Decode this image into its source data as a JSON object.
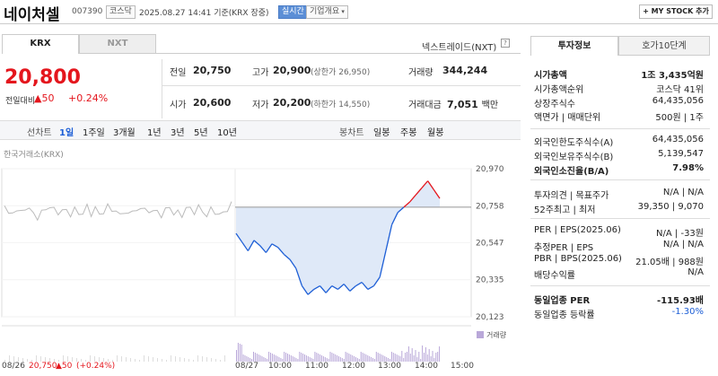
{
  "header": {
    "name": "네이처셀",
    "code": "007390",
    "market": "코스닥",
    "datetime": "2025.08.27 14:41 기준(KRX 장중)",
    "live": "실시간",
    "company": "기업개요",
    "mystock": "+ MY STOCK 추가"
  },
  "tabs": {
    "krx": "KRX",
    "nxt": "NXT",
    "next_trade": "넥스트레이드(NXT)",
    "help": "?"
  },
  "price": {
    "current": "20,800",
    "change_label": "전일대비",
    "change": "▲50",
    "change_pct": "+0.24%"
  },
  "summary": {
    "prev_label": "전일",
    "prev": "20,750",
    "high_label": "고가",
    "high": "20,900",
    "high_limit": "(상한가 26,950)",
    "volume_label": "거래량",
    "volume": "344,244",
    "open_label": "시가",
    "open": "20,600",
    "low_label": "저가",
    "low": "20,200",
    "low_limit": "(하한가 14,550)",
    "amount_label": "거래대금",
    "amount": "7,051",
    "amount_unit": "백만"
  },
  "periods": {
    "line_label": "선차트",
    "items": [
      "1일",
      "1주일",
      "3개월",
      "1년",
      "3년",
      "5년",
      "10년"
    ],
    "candle_label": "봉차트",
    "candles": [
      "일봉",
      "주봉",
      "월봉"
    ]
  },
  "chart_data": {
    "type": "line",
    "source": "한국거래소(KRX)",
    "y_ticks": [
      "20,970",
      "20,758",
      "20,547",
      "20,335",
      "20,123"
    ],
    "ylim": [
      20123,
      20970
    ],
    "prev_close": 20750,
    "x_ticks": [
      "08/27",
      "10:00",
      "11:00",
      "12:00",
      "13:00",
      "14:00",
      "15:00"
    ],
    "prev_day": {
      "date": "08/26",
      "close": "20,750",
      "change": "▲50",
      "change_pct": "(+0.24%)"
    },
    "volume_label": "거래량",
    "colors": {
      "up": "#e4161d",
      "down": "#1e5fd6",
      "fill": "#dfe9f8",
      "prev": "#bbbbbb"
    },
    "series": [
      {
        "x": [
          "09:00",
          "09:10",
          "09:20",
          "09:30",
          "09:40",
          "09:50",
          "10:00",
          "10:10",
          "10:20",
          "10:30",
          "10:40",
          "10:50",
          "11:00",
          "11:10",
          "11:20",
          "11:30",
          "11:40",
          "11:50",
          "12:00",
          "12:10",
          "12:20",
          "12:30",
          "12:40",
          "12:50",
          "13:00",
          "13:10",
          "13:20",
          "13:30",
          "13:40",
          "13:50",
          "14:00",
          "14:10",
          "14:20",
          "14:30",
          "14:41"
        ],
        "values": [
          20600,
          20550,
          20500,
          20560,
          20530,
          20490,
          20540,
          20520,
          20480,
          20450,
          20400,
          20300,
          20250,
          20280,
          20300,
          20260,
          20300,
          20280,
          20310,
          20270,
          20300,
          20320,
          20280,
          20300,
          20350,
          20500,
          20650,
          20720,
          20750,
          20780,
          20820,
          20860,
          20900,
          20850,
          20800
        ]
      }
    ]
  },
  "invest": {
    "tab1": "투자정보",
    "tab2": "호가10단계",
    "rows": [
      {
        "label": "시가총액",
        "value": "1조 3,435억원",
        "bold": true
      },
      {
        "label": "시가총액순위",
        "value": "코스닥 41위"
      },
      {
        "label": "상장주식수",
        "value": "64,435,056"
      },
      {
        "label": "액면가 | 매매단위",
        "value": "500원 | 1주"
      },
      {
        "label": "외국인한도주식수(A)",
        "value": "64,435,056"
      },
      {
        "label": "외국인보유주식수(B)",
        "value": "5,139,547"
      },
      {
        "label": "외국인소진율(B/A)",
        "value": "7.98%",
        "bold": true
      },
      {
        "label": "투자의견 | 목표주가",
        "value": "N/A | N/A"
      },
      {
        "label": "52주최고 | 최저",
        "value": "39,350 | 9,070"
      },
      {
        "label": "PER | EPS(2025.06)",
        "value": "N/A | -33원"
      },
      {
        "label": "추정PER | EPS",
        "value": "N/A | N/A"
      },
      {
        "label": "PBR | BPS(2025.06)",
        "value": "21.05배 | 988원"
      },
      {
        "label": "배당수익률",
        "value": "N/A"
      },
      {
        "label": "동일업종 PER",
        "value": "-115.93배",
        "bold": true
      },
      {
        "label": "동일업종 등락률",
        "value": "-1.30%",
        "blue": true
      }
    ]
  }
}
